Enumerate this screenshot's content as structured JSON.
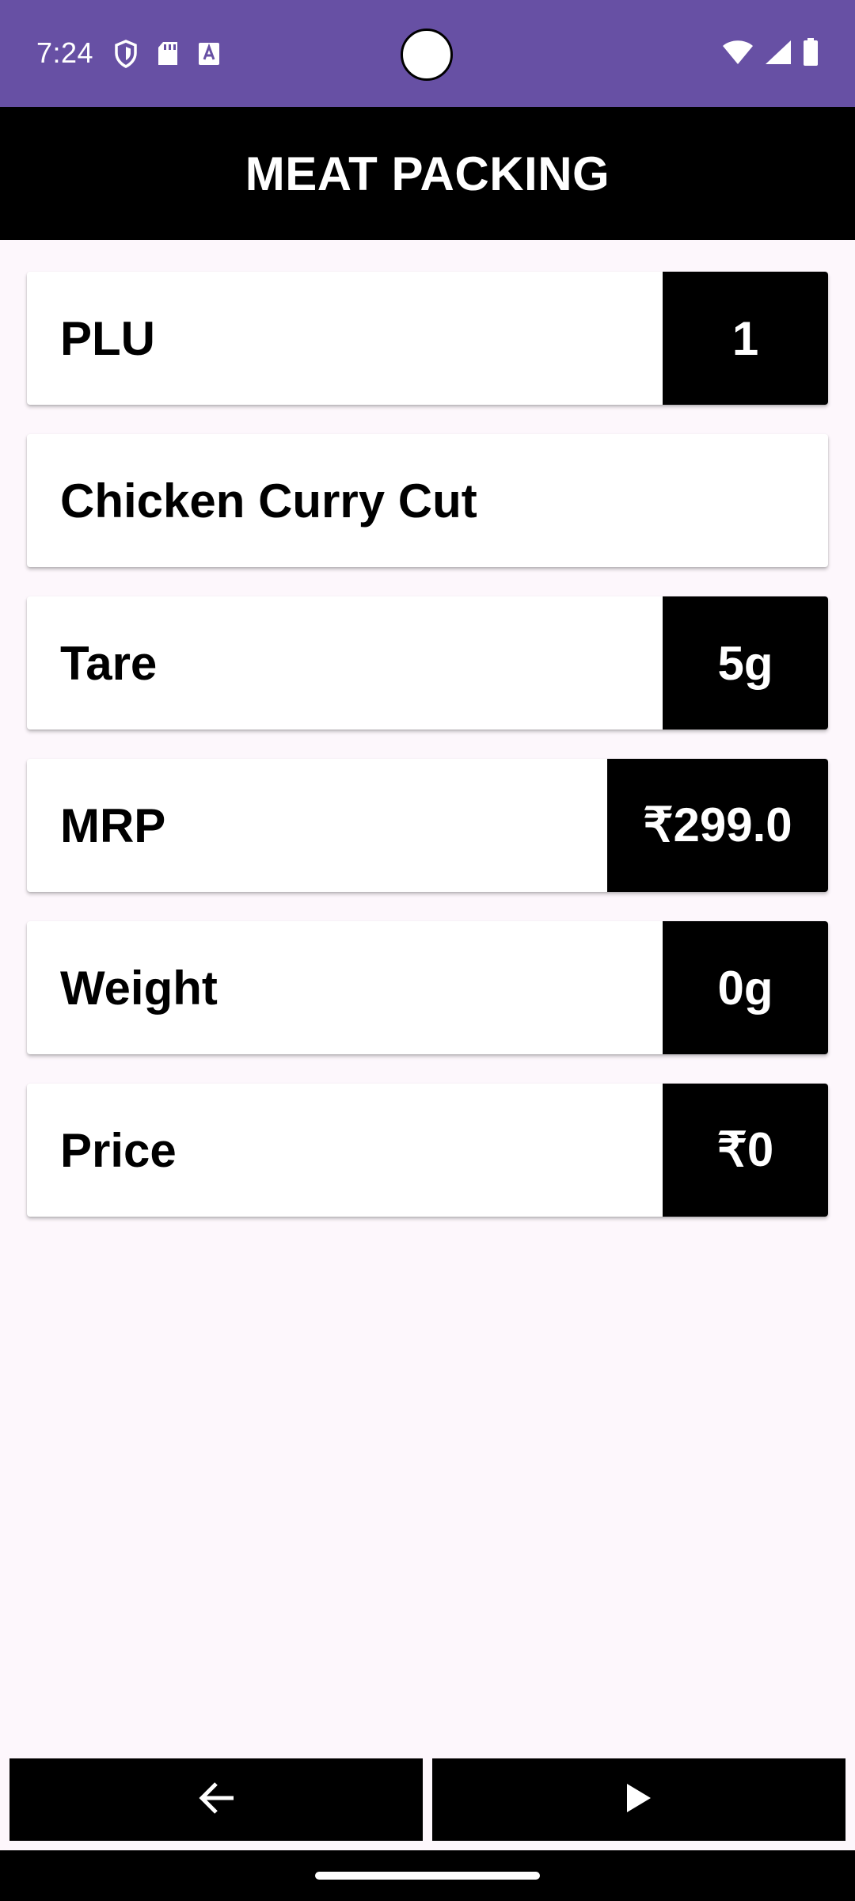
{
  "status_bar": {
    "time": "7:24",
    "background_color": "#6750a4",
    "left_icons": [
      "shield-icon",
      "sd-card-icon",
      "font-download-icon"
    ],
    "right_icons": [
      "wifi-icon",
      "cell-signal-icon",
      "battery-icon"
    ]
  },
  "app_bar": {
    "title": "MEAT PACKING",
    "background_color": "#000000"
  },
  "fields": {
    "plu": {
      "label": "PLU",
      "value": "1"
    },
    "product": {
      "label": "Chicken Curry Cut"
    },
    "tare": {
      "label": "Tare",
      "value": "5g"
    },
    "mrp": {
      "label": "MRP",
      "value": "₹299.0"
    },
    "weight": {
      "label": "Weight",
      "value": "0g"
    },
    "price": {
      "label": "Price",
      "value": "₹0"
    }
  },
  "buttons": {
    "back_icon": "arrow-left-icon",
    "next_icon": "play-icon"
  }
}
